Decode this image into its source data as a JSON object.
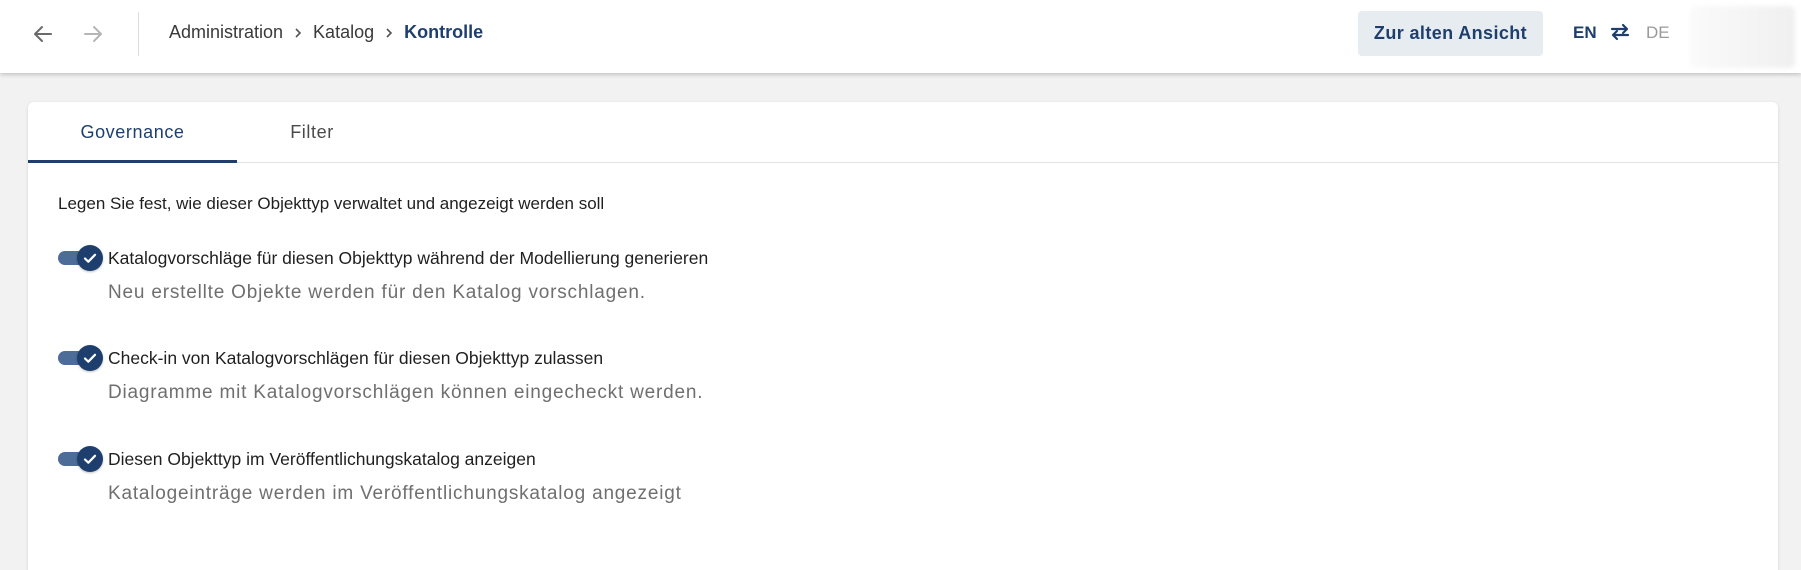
{
  "topbar": {
    "back_icon": "arrow-left-icon",
    "forward_icon": "arrow-right-icon",
    "breadcrumb": [
      "Administration",
      "Katalog",
      "Kontrolle"
    ],
    "old_view_button": "Zur alten Ansicht",
    "lang_en": "EN",
    "lang_de": "DE",
    "swap_icon": "swap-arrows-icon"
  },
  "tabs": [
    "Governance",
    "Filter"
  ],
  "intro": "Legen Sie fest, wie dieser Objekttyp verwaltet und angezeigt werden soll",
  "settings": [
    {
      "label": "Katalogvorschläge für diesen Objekttyp während der Modellierung generieren",
      "description": "Neu erstellte Objekte werden für den Katalog vorschlagen.",
      "enabled": true
    },
    {
      "label": "Check-in von Katalogvorschlägen für diesen Objekttyp zulassen",
      "description": "Diagramme mit Katalogvorschlägen können eingecheckt werden.",
      "enabled": true
    },
    {
      "label": "Diesen Objekttyp im Veröffentlichungskatalog anzeigen",
      "description": "Katalogeinträge werden im Veröffentlichungskatalog angezeigt",
      "enabled": true
    }
  ],
  "colors": {
    "primary": "#1e3f6e",
    "toggle_track": "#4d6c97",
    "button_bg": "#e7ecf1",
    "page_bg": "#f2f2f2"
  }
}
